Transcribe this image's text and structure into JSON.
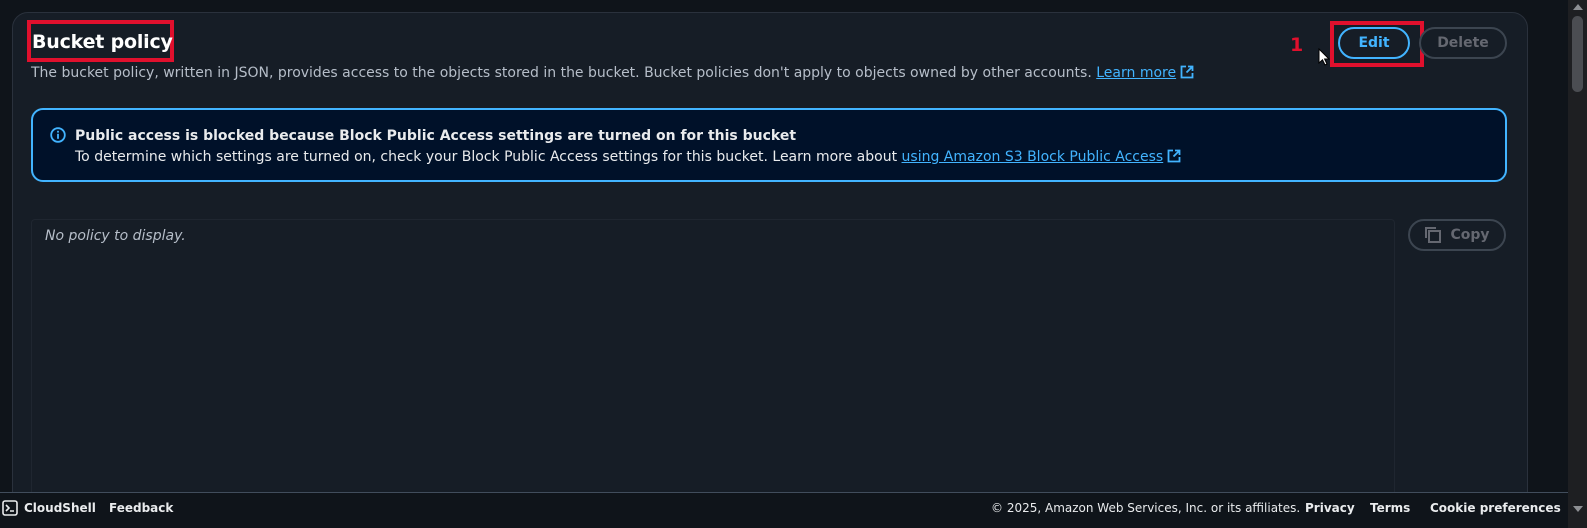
{
  "section": {
    "title": "Bucket policy",
    "description": "The bucket policy, written in JSON, provides access to the objects stored in the bucket. Bucket policies don't apply to objects owned by other accounts.",
    "learn_more": "Learn more"
  },
  "annotation": {
    "step_number": "1"
  },
  "actions": {
    "edit_label": "Edit",
    "delete_label": "Delete",
    "copy_label": "Copy"
  },
  "alert": {
    "title": "Public access is blocked because Block Public Access settings are turned on for this bucket",
    "body": "To determine which settings are turned on, check your Block Public Access settings for this bucket. Learn more about",
    "link": "using Amazon S3 Block Public Access"
  },
  "policy": {
    "empty_text": "No policy to display."
  },
  "footer": {
    "cloudshell": "CloudShell",
    "feedback": "Feedback",
    "copyright": "© 2025, Amazon Web Services, Inc. or its affiliates.",
    "privacy": "Privacy",
    "terms": "Terms",
    "cookies": "Cookie preferences"
  },
  "colors": {
    "accent": "#42b4ff",
    "highlight": "#e0102d",
    "background": "#0f141a",
    "card": "#161d26",
    "alert_bg": "#001129"
  },
  "icons": {
    "info": "info-circle-icon",
    "external": "external-link-icon",
    "copy": "copy-icon",
    "cloudshell": "terminal-icon",
    "cursor": "mouse-pointer-icon"
  }
}
